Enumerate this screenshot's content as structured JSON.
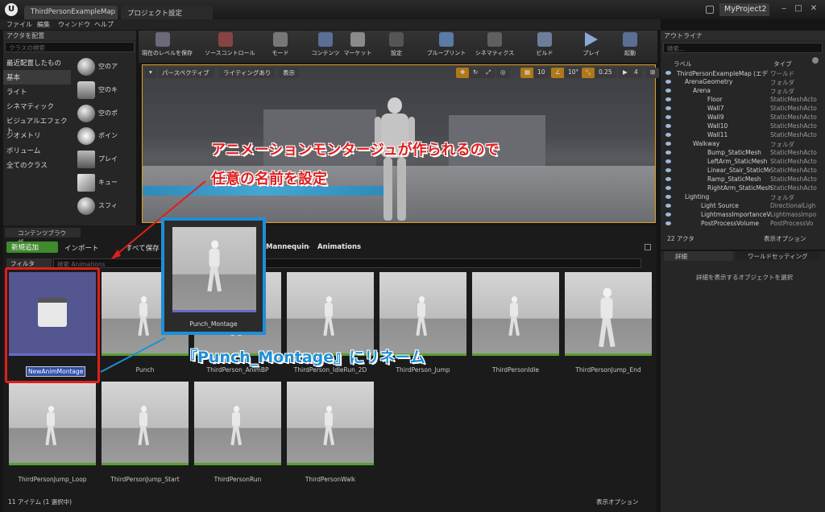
{
  "titlebar": {
    "tabs": [
      "ThirdPersonExampleMap",
      "プロジェクト設定"
    ],
    "project": "MyProject2",
    "logo": "U"
  },
  "menu": [
    "ファイル",
    "編集",
    "ウィンドウ",
    "ヘルプ"
  ],
  "place_panel": {
    "title": "アクタを配置",
    "search_placeholder": "クラスの検索",
    "categories": [
      "最近配置したもの",
      "基本",
      "ライト",
      "シネマティック",
      "ビジュアルエフェクト",
      "ジオメトリ",
      "ボリューム",
      "全てのクラス"
    ],
    "items": [
      "空のア",
      "空のキ",
      "空のポ",
      "ポイン",
      "プレイ",
      "キュー",
      "スフィ"
    ]
  },
  "toolbar": [
    "現在のレベルを保存",
    "ソースコントロール",
    "モード",
    "コンテンツ",
    "マーケット",
    "設定",
    "ブループリント",
    "シネマティクス",
    "ビルド",
    "プレイ",
    "起動"
  ],
  "viewport": {
    "perspective": "パースペクティブ",
    "lighting": "ライティングあり",
    "show": "表示",
    "grid": "10",
    "angle": "10°",
    "scale": "0.25",
    "camera": "4"
  },
  "outliner": {
    "title": "アウトライナ",
    "search_placeholder": "検索...",
    "col_label": "ラベル",
    "col_type": "タイプ",
    "rows": [
      {
        "name": "ThirdPersonExampleMap (エデ",
        "type": "ワールド"
      },
      {
        "name": "ArenaGeometry",
        "type": "フォルダ"
      },
      {
        "name": "Arena",
        "type": "フォルダ"
      },
      {
        "name": "Floor",
        "type": "StaticMeshActo"
      },
      {
        "name": "Wall7",
        "type": "StaticMeshActo"
      },
      {
        "name": "Wall9",
        "type": "StaticMeshActo"
      },
      {
        "name": "Wall10",
        "type": "StaticMeshActo"
      },
      {
        "name": "Wall11",
        "type": "StaticMeshActo"
      },
      {
        "name": "Walkway",
        "type": "フォルダ"
      },
      {
        "name": "Bump_StaticMesh",
        "type": "StaticMeshActo"
      },
      {
        "name": "LeftArm_StaticMesh",
        "type": "StaticMeshActo"
      },
      {
        "name": "Linear_Stair_StaticMesh",
        "type": "StaticMeshActo"
      },
      {
        "name": "Ramp_StaticMesh",
        "type": "StaticMeshActo"
      },
      {
        "name": "RightArm_StaticMesh",
        "type": "StaticMeshActo"
      },
      {
        "name": "Lighting",
        "type": "フォルダ"
      },
      {
        "name": "Light Source",
        "type": "DirectionalLigh"
      },
      {
        "name": "LightmassImportanceVolu",
        "type": "LightmassImpo"
      },
      {
        "name": "PostProcessVolume",
        "type": "PostProcessVo"
      }
    ],
    "count": "22 アクタ",
    "view_options": "表示オプション"
  },
  "details": {
    "tab1": "詳細",
    "tab2": "ワールドセッティング",
    "empty_msg": "詳細を表示するオブジェクトを選択"
  },
  "content_browser": {
    "title": "コンテンツブラウザ",
    "add_new": "新規追加",
    "import": "インポート",
    "save_all": "すべて保存",
    "path": [
      "Mannequin",
      "Animations"
    ],
    "filter": "フィルタ",
    "search_placeholder": "検索 Animations",
    "assets": [
      "NewAnimMontage",
      "Punch",
      "ThirdPerson_AnimBP",
      "ThirdPerson_IdleRun_2D",
      "ThirdPerson_Jump",
      "ThirdPersonIdle",
      "ThirdPersonJump_End",
      "ThirdPersonJump_Loop",
      "ThirdPersonJump_Start",
      "ThirdPersonRun",
      "ThirdPersonWalk"
    ],
    "preview_label": "Punch_Montage",
    "status": "11 アイテム (1 選択中)",
    "view_options": "表示オプション"
  },
  "annotations": {
    "line1": "アニメーションモンタージュが作られるので",
    "line2": "任意の名前を設定",
    "rename": "『Punch_Montage』にリネーム"
  },
  "colors": {
    "red": "#e01e1e",
    "blue": "#1f8fd6",
    "green": "#58a030",
    "montage_blue": "#545691"
  }
}
